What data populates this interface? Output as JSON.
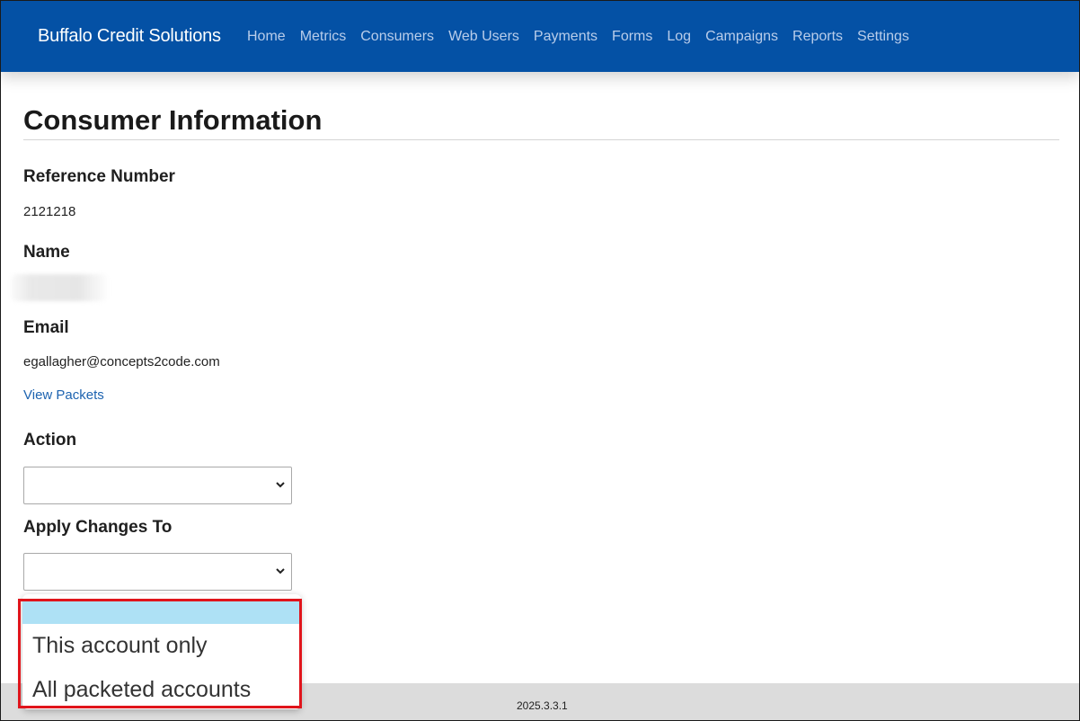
{
  "header": {
    "brand": "Buffalo Credit Solutions",
    "nav": [
      "Home",
      "Metrics",
      "Consumers",
      "Web Users",
      "Payments",
      "Forms",
      "Log",
      "Campaigns",
      "Reports",
      "Settings"
    ],
    "background_color": "#0451a5"
  },
  "main": {
    "title": "Consumer Information",
    "reference_label": "Reference Number",
    "reference_value": "2121218",
    "name_label": "Name",
    "email_label": "Email",
    "email_value": "egallagher@concepts2code.com",
    "view_packets_link": "View Packets",
    "action_label": "Action",
    "action_value": "",
    "apply_label": "Apply Changes To",
    "apply_value": ""
  },
  "dropdown": {
    "options": [
      "",
      "This account only",
      "All packeted accounts"
    ],
    "selected_index": 0,
    "highlight_color": "#aee1f5",
    "annotation_color": "#e0141b"
  },
  "footer": {
    "version": "2025.3.3.1"
  }
}
